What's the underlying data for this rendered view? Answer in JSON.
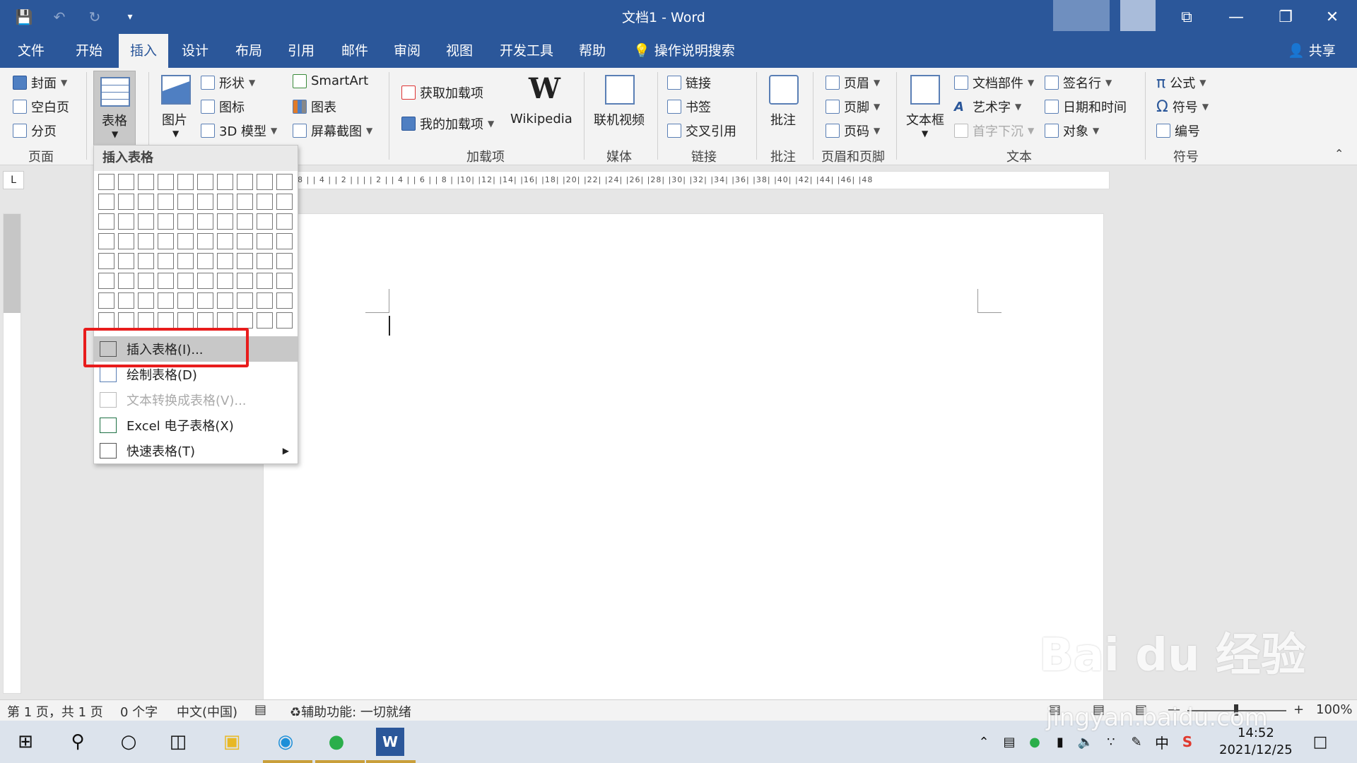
{
  "title": "文档1  -  Word",
  "tabs": [
    "文件",
    "开始",
    "插入",
    "设计",
    "布局",
    "引用",
    "邮件",
    "审阅",
    "视图",
    "开发工具",
    "帮助"
  ],
  "active_tab": "插入",
  "tell_me": "操作说明搜索",
  "share": "共享",
  "ribbon": {
    "pages": {
      "cover": "封面",
      "blank": "空白页",
      "break": "分页",
      "label": "页面"
    },
    "table": {
      "label": "表格"
    },
    "illustrations": {
      "picture": "图片",
      "shapes": "形状",
      "icons": "图标",
      "model3d": "3D 模型",
      "smartart": "SmartArt",
      "chart": "图表",
      "screenshot": "屏幕截图"
    },
    "addins": {
      "get": "获取加载项",
      "mine": "我的加载项",
      "wikipedia": "Wikipedia",
      "wiki_glyph": "W",
      "label": "加载项"
    },
    "media": {
      "video": "联机视频",
      "label": "媒体"
    },
    "links": {
      "link": "链接",
      "bookmark": "书签",
      "crossref": "交叉引用",
      "label": "链接"
    },
    "comments": {
      "comment": "批注",
      "label": "批注"
    },
    "header_footer": {
      "header": "页眉",
      "footer": "页脚",
      "page_number": "页码",
      "label": "页眉和页脚"
    },
    "text": {
      "textbox": "文本框",
      "quickparts": "文档部件",
      "wordart": "艺术字",
      "dropcap": "首字下沉",
      "signature": "签名行",
      "datetime": "日期和时间",
      "object": "对象",
      "label": "文本"
    },
    "symbols": {
      "equation": "公式",
      "symbol": "符号",
      "number": "编号",
      "label": "符号"
    }
  },
  "ruler_text": "8 |  | 4 |  | 2 |  |  |  | 2 |  | 4 |  | 6 |  | 8 |  |10|  |12|  |14|  |16|  |18|  |20|  |22|  |24|  |26|  |28|  |30|  |32|  |34|  |36|  |38|  |40|  |42|  |44|  |46|  |48",
  "menu": {
    "title": "插入表格",
    "grid_rows": 8,
    "grid_cols": 10,
    "items": [
      {
        "label": "插入表格(I)...",
        "state": "hover"
      },
      {
        "label": "绘制表格(D)",
        "state": "normal"
      },
      {
        "label": "文本转换成表格(V)...",
        "state": "disabled"
      },
      {
        "label": "Excel 电子表格(X)",
        "state": "normal"
      },
      {
        "label": "快速表格(T)",
        "state": "normal"
      }
    ]
  },
  "status": {
    "page": "第 1 页，共 1 页",
    "words": "0 个字",
    "language": "中文(中国)",
    "accessibility": "辅助功能: 一切就绪",
    "zoom": "100%"
  },
  "taskbar": {
    "time": "14:52",
    "date": "2021/12/25",
    "ime": "中"
  },
  "watermark": {
    "line1": "Bai du 经验",
    "line2": "jingyan.baidu.com"
  },
  "colors": {
    "brand": "#2b579a",
    "highlight": "#e81c1c"
  }
}
